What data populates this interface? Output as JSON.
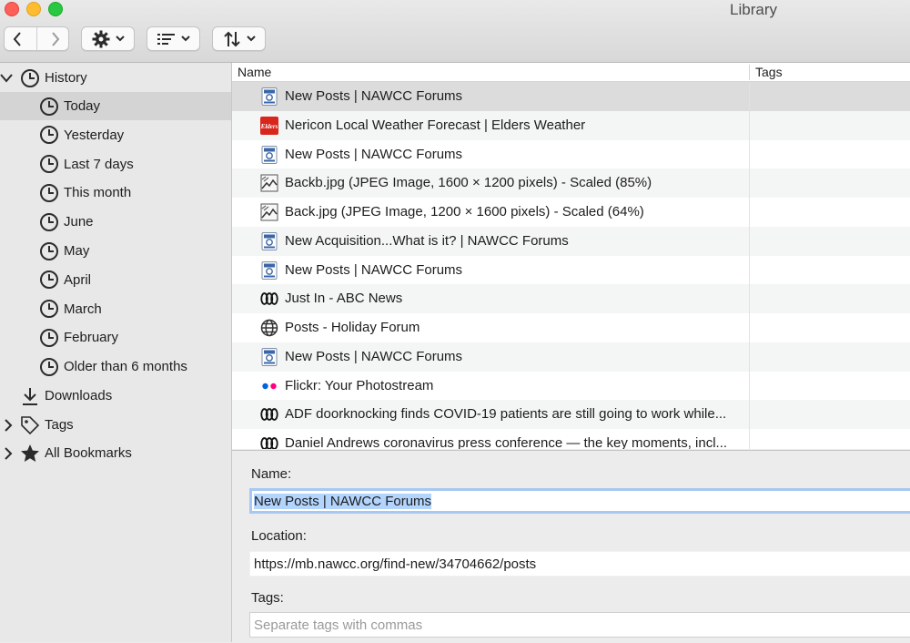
{
  "window": {
    "title": "Library"
  },
  "toolbar": {
    "back_icon": "chevron-left-icon",
    "forward_icon": "chevron-right-icon",
    "organize_icon": "gear-icon",
    "views_icon": "list-icon",
    "import_export_icon": "up-down-arrows-icon"
  },
  "sidebar": {
    "history": "History",
    "items": [
      {
        "label": "Today",
        "selected": true
      },
      {
        "label": "Yesterday"
      },
      {
        "label": "Last 7 days"
      },
      {
        "label": "This month"
      },
      {
        "label": "June"
      },
      {
        "label": "May"
      },
      {
        "label": "April"
      },
      {
        "label": "March"
      },
      {
        "label": "February"
      },
      {
        "label": "Older than 6 months"
      }
    ],
    "downloads": "Downloads",
    "tags": "Tags",
    "all_bookmarks": "All Bookmarks"
  },
  "list": {
    "columns": {
      "name": "Name",
      "tags": "Tags"
    },
    "rows": [
      {
        "title": "New Posts | NAWCC Forums",
        "icon": "nawcc-icon",
        "selected": true
      },
      {
        "title": "Nericon Local Weather Forecast | Elders Weather",
        "icon": "elders-icon"
      },
      {
        "title": "New Posts | NAWCC Forums",
        "icon": "nawcc-icon"
      },
      {
        "title": "Backb.jpg (JPEG Image, 1600 × 1200 pixels) - Scaled (85%)",
        "icon": "image-icon"
      },
      {
        "title": "Back.jpg (JPEG Image, 1200 × 1600 pixels) - Scaled (64%)",
        "icon": "image-icon"
      },
      {
        "title": "New Acquisition...What is it? | NAWCC Forums",
        "icon": "nawcc-icon"
      },
      {
        "title": "New Posts | NAWCC Forums",
        "icon": "nawcc-icon"
      },
      {
        "title": "Just In - ABC News",
        "icon": "abc-icon"
      },
      {
        "title": "Posts - Holiday Forum",
        "icon": "globe-icon"
      },
      {
        "title": "New Posts | NAWCC Forums",
        "icon": "nawcc-icon"
      },
      {
        "title": "Flickr: Your Photostream",
        "icon": "flickr-icon"
      },
      {
        "title": "ADF doorknocking finds COVID-19 patients are still going to work while...",
        "icon": "abc-icon"
      },
      {
        "title": "Daniel Andrews coronavirus press conference — the key moments, incl...",
        "icon": "abc-icon"
      }
    ]
  },
  "detail": {
    "name_label": "Name:",
    "name_value": "New Posts | NAWCC Forums",
    "location_label": "Location:",
    "location_value": "https://mb.nawcc.org/find-new/34704662/posts",
    "tags_label": "Tags:",
    "tags_placeholder": "Separate tags with commas"
  }
}
